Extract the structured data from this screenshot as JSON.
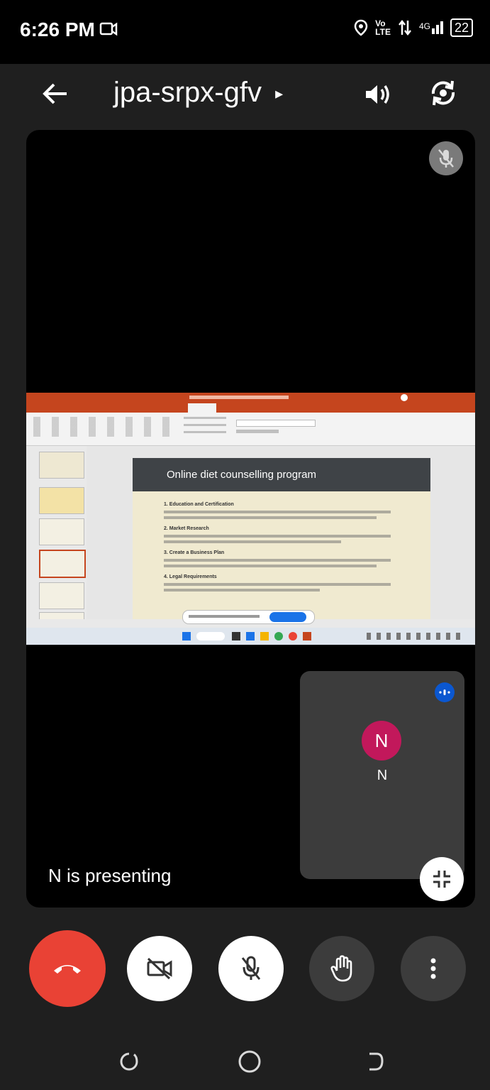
{
  "status_bar": {
    "time": "6:26 PM",
    "network": "4G",
    "battery": "22"
  },
  "top_bar": {
    "meeting_code": "jpa-srpx-gfv",
    "expand_caret": "▸"
  },
  "shared_screen": {
    "slide_title": "Online diet counselling program",
    "sections": [
      "1. Education and Certification",
      "2. Market Research",
      "3. Create a Business Plan",
      "4. Legal Requirements"
    ]
  },
  "participant_tile": {
    "initial": "N",
    "name": "N"
  },
  "presenting_text": "N is presenting"
}
